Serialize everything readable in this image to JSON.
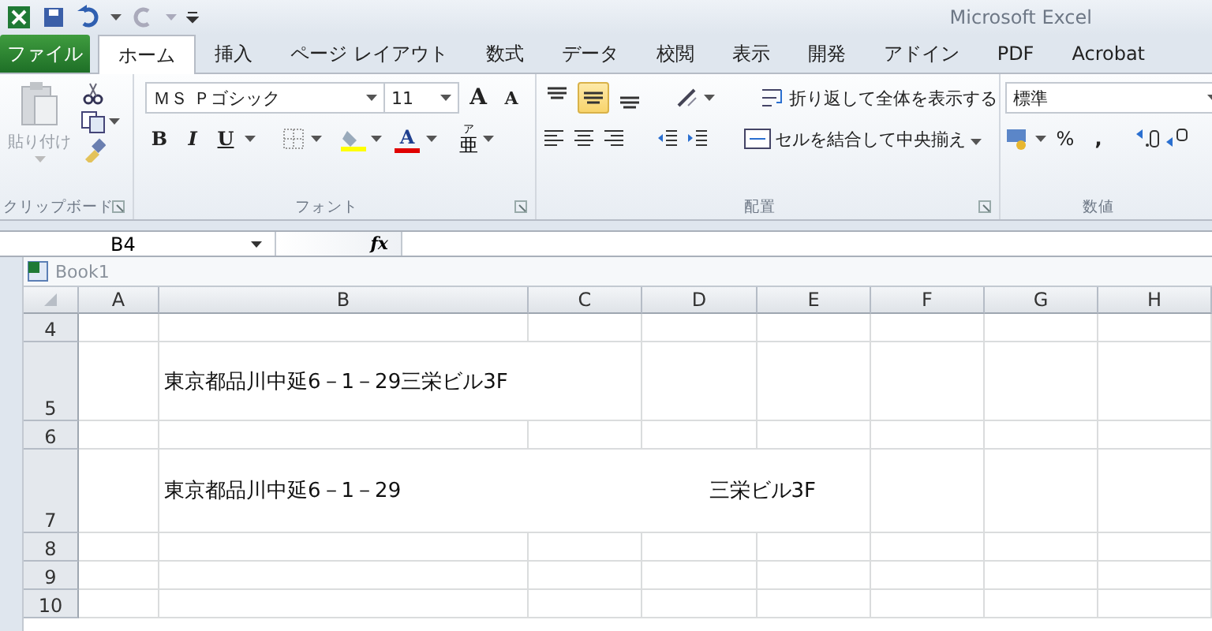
{
  "window": {
    "title": "Microsoft Excel"
  },
  "tabs": [
    {
      "label": "ファイル",
      "kind": "file",
      "selected": false
    },
    {
      "label": "ホーム",
      "kind": "tab",
      "selected": true
    },
    {
      "label": "挿入",
      "kind": "tab",
      "selected": false
    },
    {
      "label": "ページ レイアウト",
      "kind": "tab",
      "selected": false
    },
    {
      "label": "数式",
      "kind": "tab",
      "selected": false
    },
    {
      "label": "データ",
      "kind": "tab",
      "selected": false
    },
    {
      "label": "校閲",
      "kind": "tab",
      "selected": false
    },
    {
      "label": "表示",
      "kind": "tab",
      "selected": false
    },
    {
      "label": "開発",
      "kind": "tab",
      "selected": false
    },
    {
      "label": "アドイン",
      "kind": "tab",
      "selected": false
    },
    {
      "label": "PDF",
      "kind": "tab",
      "selected": false
    },
    {
      "label": "Acrobat",
      "kind": "tab",
      "selected": false
    }
  ],
  "ribbon": {
    "clipboard": {
      "label": "クリップボード",
      "paste": "貼り付け"
    },
    "font": {
      "label": "フォント",
      "font_name": "ＭＳ Ｐゴシック",
      "font_size": "11",
      "grow": "A",
      "shrink": "A",
      "bold": "B",
      "italic": "I",
      "underline": "U",
      "font_color": "A",
      "phonetic": "亜",
      "phonetic_ruby": "ア"
    },
    "alignment": {
      "label": "配置",
      "vertical": [
        {
          "kind": "top",
          "selected": false
        },
        {
          "kind": "middle",
          "selected": true
        },
        {
          "kind": "bottom",
          "selected": false
        }
      ],
      "wrap_text": "折り返して全体を表示する",
      "merge_center": "セルを結合して中央揃え"
    },
    "number": {
      "label": "数値",
      "format": "標準",
      "percent": "%",
      "comma": ","
    }
  },
  "formula_bar": {
    "name_box": "B4",
    "fx": "fx"
  },
  "workbook": {
    "title": "Book1"
  },
  "sheet": {
    "columns": [
      "A",
      "B",
      "C",
      "D",
      "E",
      "F",
      "G",
      "H"
    ],
    "rows": [
      {
        "number": "4",
        "tall": false,
        "cells": []
      },
      {
        "number": "5",
        "tall": true,
        "cells": [
          {
            "kind": "overflow",
            "texts": [
              "東京都品川中延6－1－29三栄ビル3F"
            ]
          }
        ]
      },
      {
        "number": "6",
        "tall": false,
        "cells": []
      },
      {
        "number": "7",
        "tall": true,
        "cells": [
          {
            "kind": "merged",
            "texts": [
              "東京都品川中延6－1－29",
              "三栄ビル3F"
            ]
          }
        ]
      },
      {
        "number": "8",
        "tall": false,
        "cells": []
      },
      {
        "number": "9",
        "tall": false,
        "cells": []
      },
      {
        "number": "10",
        "tall": false,
        "cells": []
      }
    ]
  }
}
